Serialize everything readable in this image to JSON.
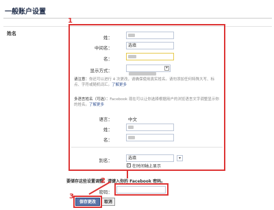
{
  "page": {
    "title": "一般账户设置"
  },
  "section": {
    "label": "姓名"
  },
  "form": {
    "last_name": {
      "label": "姓：",
      "value": ""
    },
    "middle_name": {
      "label": "中间名：",
      "value": "选填"
    },
    "first_name": {
      "label": "名：",
      "value": ""
    },
    "display_as": {
      "label": "显示方式："
    },
    "note": {
      "label": "请注意：",
      "text": "你还可以进行 4 次更改，请确保使用真实姓名。请勿添加任何特殊大写、标点、字符或随机词汇。",
      "link": "了解更多"
    },
    "multilang": {
      "label": "多语言姓名（可选）：",
      "text": "Facebook 现在可以让你选择根据用户的浏览语言文字调整显示你的姓名。",
      "link": "了解更多"
    },
    "language": {
      "label": "语言：",
      "value": "中文"
    },
    "ml_last": {
      "label": "姓："
    },
    "ml_first": {
      "label": "名："
    },
    "alt_name": {
      "label": "别名：",
      "value": "选填"
    },
    "timeline_check": {
      "label": "在时间轴上显示"
    },
    "password_prompt": "要储存这些设置调整，请键入你的 Facebook 密码。",
    "password_label": "密码：",
    "save_button": "保存更改",
    "cancel_button": "取消"
  },
  "annotations": {
    "n1": "1",
    "n2": "2",
    "n3": "3"
  },
  "colors": {
    "annotation": "#dd3333",
    "button": "#5b74a8",
    "link": "#3b5998"
  }
}
